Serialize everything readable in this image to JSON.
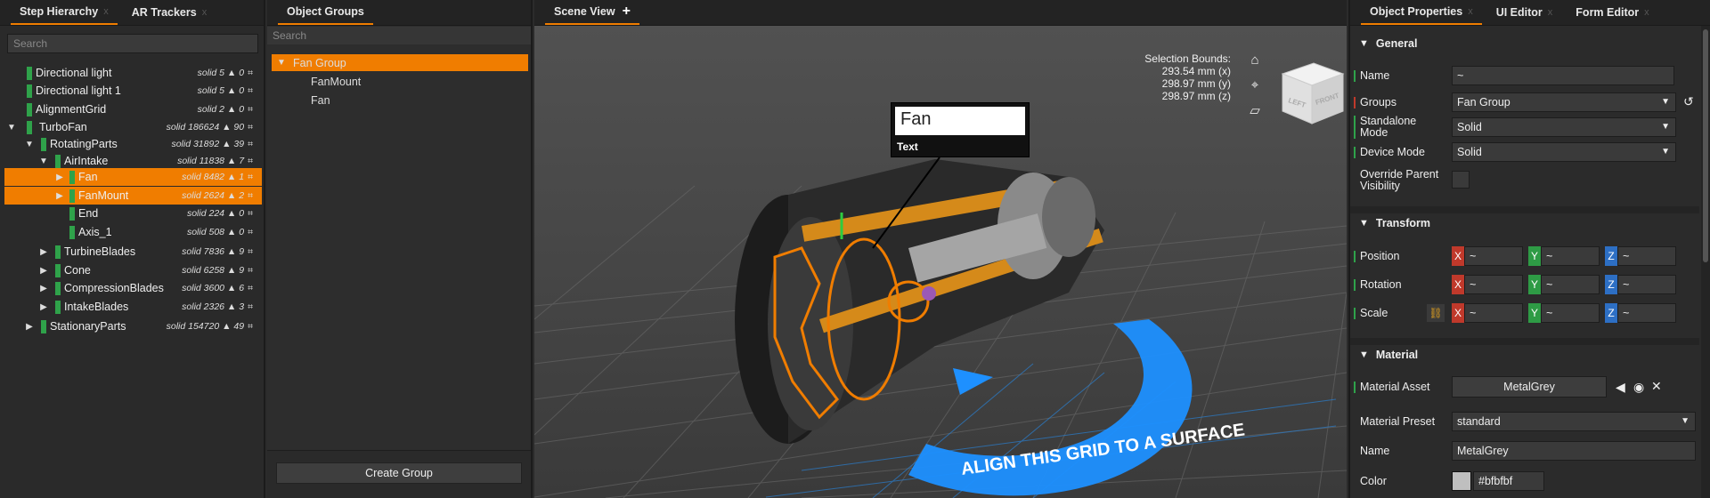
{
  "hierarchy": {
    "tabs": [
      {
        "label": "Step Hierarchy"
      },
      {
        "label": "AR Trackers"
      }
    ],
    "search_placeholder": "Search",
    "rows": [
      {
        "label": "Directional light",
        "stats": "solid 5 ▲ 0",
        "arrow": ""
      },
      {
        "label": "Directional light 1",
        "stats": "solid 5 ▲ 0",
        "arrow": ""
      },
      {
        "label": "AlignmentGrid",
        "stats": "solid 2 ▲ 0",
        "arrow": ""
      },
      {
        "label": "TurboFan",
        "stats": "solid 186624 ▲ 90",
        "arrow": "▼"
      },
      {
        "label": "RotatingParts",
        "stats": "solid 31892 ▲ 39",
        "arrow": "▼"
      },
      {
        "label": "AirIntake",
        "stats": "solid 11838 ▲ 7",
        "arrow": "▼"
      },
      {
        "label": "Fan",
        "stats": "solid 8482 ▲ 1",
        "arrow": "▶"
      },
      {
        "label": "FanMount",
        "stats": "solid 2624 ▲ 2",
        "arrow": "▶"
      },
      {
        "label": "End",
        "stats": "solid 224 ▲ 0",
        "arrow": ""
      },
      {
        "label": "Axis_1",
        "stats": "solid 508 ▲ 0",
        "arrow": ""
      },
      {
        "label": "TurbineBlades",
        "stats": "solid 7836 ▲ 9",
        "arrow": "▶"
      },
      {
        "label": "Cone",
        "stats": "solid 6258 ▲ 9",
        "arrow": "▶"
      },
      {
        "label": "CompressionBlades",
        "stats": "solid 3600 ▲ 6",
        "arrow": "▶"
      },
      {
        "label": "IntakeBlades",
        "stats": "solid 2326 ▲ 3",
        "arrow": "▶"
      },
      {
        "label": "StationaryParts",
        "stats": "solid 154720 ▲ 49",
        "arrow": "▶"
      }
    ]
  },
  "groups": {
    "tab": "Object Groups",
    "search_placeholder": "Search",
    "items": [
      {
        "label": "Fan Group",
        "arrow": "▼"
      },
      {
        "label": "FanMount",
        "arrow": ""
      },
      {
        "label": "Fan",
        "arrow": ""
      }
    ],
    "create_label": "Create Group"
  },
  "scene": {
    "tab": "Scene View",
    "bounds_title": "Selection Bounds:",
    "bounds_x": "293.54 mm (x)",
    "bounds_y": "298.97 mm (y)",
    "bounds_z": "298.97 mm (z)",
    "cube_left": "LEFT",
    "cube_front": "FRONT",
    "label_text": "Fan",
    "label_caption": "Text",
    "grid_text": "ALIGN THIS GRID TO A SURFACE"
  },
  "props": {
    "tabs": [
      {
        "label": "Object Properties"
      },
      {
        "label": "UI Editor"
      },
      {
        "label": "Form Editor"
      }
    ],
    "general": {
      "title": "General",
      "name_label": "Name",
      "name_value": "~",
      "groups_label": "Groups",
      "groups_value": "Fan Group",
      "standalone_label": "Standalone Mode",
      "standalone_value": "Solid",
      "device_label": "Device Mode",
      "device_value": "Solid",
      "override_label": "Override Parent Visibility"
    },
    "transform": {
      "title": "Transform",
      "position_label": "Position",
      "rotation_label": "Rotation",
      "scale_label": "Scale",
      "x": "X",
      "y": "Y",
      "z": "Z",
      "value": "~"
    },
    "material": {
      "title": "Material",
      "asset_label": "Material Asset",
      "asset_value": "MetalGrey",
      "preset_label": "Material Preset",
      "preset_value": "standard",
      "name_label": "Name",
      "name_value": "MetalGrey",
      "color_label": "Color",
      "color_value": "#bfbfbf"
    }
  },
  "colors": {
    "accent": "#f07d00",
    "tree_bar": "#2fa24a",
    "grid_blue": "#1e90ff"
  }
}
